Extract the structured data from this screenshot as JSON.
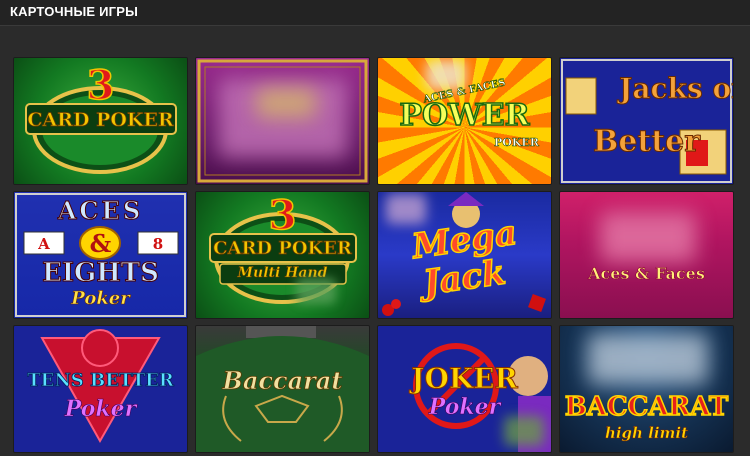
{
  "section": {
    "title": "КАРТОЧНЫЕ ИГРЫ"
  },
  "games": [
    {
      "id": "three-card-poker",
      "logo_number": "3",
      "logo_main": "CARD POKER"
    },
    {
      "id": "blurred-purple-game"
    },
    {
      "id": "aces-faces-power-poker",
      "logo_top": "ACES & FACES",
      "logo_main": "POWER",
      "logo_sub": "POKER"
    },
    {
      "id": "jacks-or-better",
      "logo_line1": "Jacks or",
      "logo_line2": "Better"
    },
    {
      "id": "aces-eights-poker",
      "logo_line1": "ACES",
      "logo_card_left": "A",
      "logo_amp": "&",
      "logo_card_right": "8",
      "logo_line2": "EIGHTS",
      "logo_sub": "Poker"
    },
    {
      "id": "three-card-poker-multihand",
      "logo_number": "3",
      "logo_main": "CARD POKER",
      "logo_sub": "Multi Hand"
    },
    {
      "id": "mega-jack",
      "logo_line1": "Mega",
      "logo_line2": "Jack"
    },
    {
      "id": "aces-faces",
      "logo_main": "Aces & Faces"
    },
    {
      "id": "tens-or-better",
      "logo_main": "TENS BETTER",
      "logo_sub": "Poker"
    },
    {
      "id": "baccarat",
      "logo_main": "Baccarat"
    },
    {
      "id": "joker-poker",
      "logo_main": "JOKER",
      "logo_sub": "Poker"
    },
    {
      "id": "baccarat-high-limit",
      "logo_main": "BACCARAT",
      "logo_sub": "high limit"
    }
  ],
  "colors": {
    "background": "#2b2b2b",
    "header": "#232323",
    "green_felt": "#1d7a2a",
    "purple": "#7a1f7a",
    "blue": "#1c2a9a",
    "gold": "#f2c400",
    "red": "#c8102e"
  }
}
